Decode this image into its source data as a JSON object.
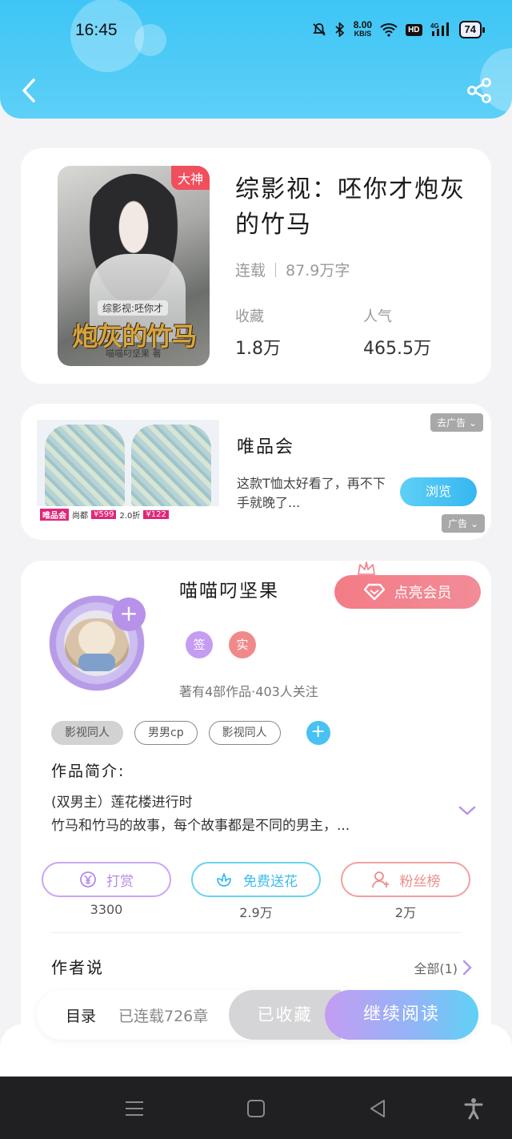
{
  "status_bar": {
    "time": "16:45",
    "speed_value": "8.00",
    "speed_unit": "KB/S",
    "hd": "HD",
    "network": "4G",
    "battery": "74"
  },
  "book": {
    "title": "综影视：呸你才炮灰的竹马",
    "status": "连载",
    "word_count": "87.9万字",
    "cover_badge": "大神",
    "cover_subtitle": "综影视:呸你才",
    "cover_title": "炮灰的竹马",
    "cover_author": "喵喵叼坚果 著",
    "favorites_label": "收藏",
    "favorites_value": "1.8万",
    "popularity_label": "人气",
    "popularity_value": "465.5万"
  },
  "ad": {
    "brand": "唯品会",
    "description": "这款T恤太好看了，再不下手就晚了...",
    "browse_label": "浏览",
    "remove_label": "去广告",
    "ad_label": "广告",
    "img_brand": "唯品会",
    "img_shop": "尚都",
    "img_price1": "¥599",
    "img_discount": "2.0折",
    "img_price2": "¥122"
  },
  "author": {
    "name": "喵喵叼坚果",
    "vip_label": "点亮会员",
    "badge_sign": "签",
    "badge_real": "实",
    "stats": "著有4部作品·403人关注",
    "tags": [
      "影视同人",
      "男男cp",
      "影视同人"
    ],
    "intro_title": "作品简介:",
    "intro_line1": "(双男主）莲花楼进行时",
    "intro_line2": "竹马和竹马的故事，每个故事都是不同的男主，...",
    "reward_label": "打赏",
    "reward_count": "3300",
    "flower_label": "免费送花",
    "flower_count": "2.9万",
    "fans_label": "粉丝榜",
    "fans_count": "2万",
    "author_say": "作者说",
    "all_label": "全部(1)"
  },
  "reading_bar": {
    "toc_label": "目录",
    "chapters": "已连载726章",
    "collected_label": "已收藏",
    "continue_label": "继续阅读"
  },
  "colors": {
    "header": "#3ec5f5",
    "vip": "#f37c86",
    "reward": "#c49cf2",
    "flower": "#47c2f2",
    "fans": "#f08a8a"
  }
}
